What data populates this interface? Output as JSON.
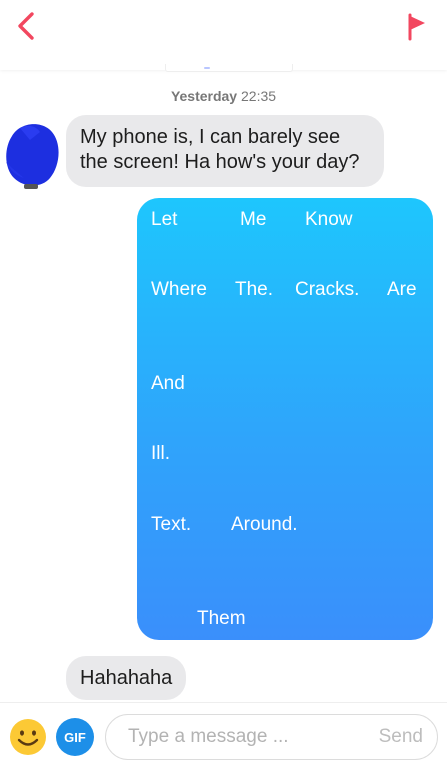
{
  "header": {
    "back_icon": "chevron-left-icon",
    "report_icon": "flag-icon",
    "accent_color": "#f2475f"
  },
  "conversation": {
    "timestamp_day": "Yesterday",
    "timestamp_time": "22:35",
    "messages": [
      {
        "direction": "incoming",
        "text": "My phone is, I can barely see the screen! Ha how's your day?"
      },
      {
        "direction": "outgoing",
        "words": [
          "Let",
          "Me",
          "Know",
          "Where",
          "The.",
          "Cracks.",
          "Are",
          "And",
          "Ill.",
          "Text.",
          "Around.",
          "Them"
        ]
      },
      {
        "direction": "incoming",
        "text": "Hahahaha"
      }
    ]
  },
  "composer": {
    "emoji_icon": "smiley-face-icon",
    "gif_label": "GIF",
    "placeholder": "Type a message ...",
    "send_label": "Send"
  }
}
